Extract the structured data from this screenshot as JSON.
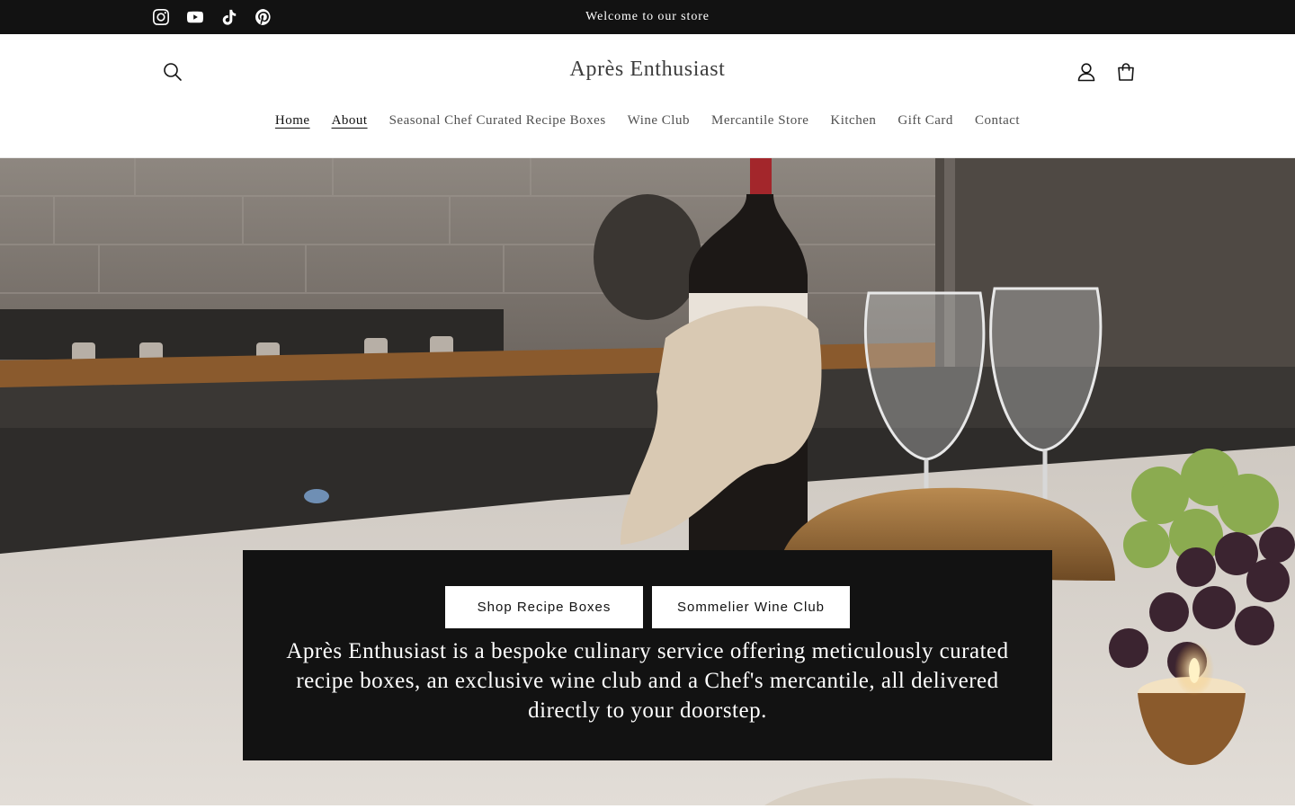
{
  "announcement": {
    "text": "Welcome to our store",
    "social": [
      {
        "name": "Instagram",
        "icon": "instagram-icon"
      },
      {
        "name": "YouTube",
        "icon": "youtube-icon"
      },
      {
        "name": "TikTok",
        "icon": "tiktok-icon"
      },
      {
        "name": "Pinterest",
        "icon": "pinterest-icon"
      }
    ]
  },
  "header": {
    "brand": "Après Enthusiast",
    "icons": {
      "search": "search-icon",
      "account": "account-icon",
      "cart": "cart-icon"
    }
  },
  "nav": {
    "items": [
      {
        "label": "Home",
        "active": true
      },
      {
        "label": "About",
        "active": true
      },
      {
        "label": "Seasonal Chef Curated Recipe Boxes",
        "active": false
      },
      {
        "label": "Wine Club",
        "active": false
      },
      {
        "label": "Mercantile Store",
        "active": false
      },
      {
        "label": "Kitchen",
        "active": false
      },
      {
        "label": "Gift Card",
        "active": false
      },
      {
        "label": "Contact",
        "active": false
      }
    ]
  },
  "hero": {
    "buttons": {
      "primary": "Shop Recipe Boxes",
      "secondary": "Sommelier Wine Club"
    },
    "text": "Après Enthusiast is a bespoke culinary service offering meticulously curated recipe boxes, an exclusive wine club and a Chef's mercantile, all delivered directly to your doorstep."
  },
  "colors": {
    "announcement_bg": "#121212",
    "hero_box_bg": "#121212",
    "text_dark": "#121212",
    "brand_text": "#3d3d3d",
    "button_bg": "#ffffff"
  }
}
